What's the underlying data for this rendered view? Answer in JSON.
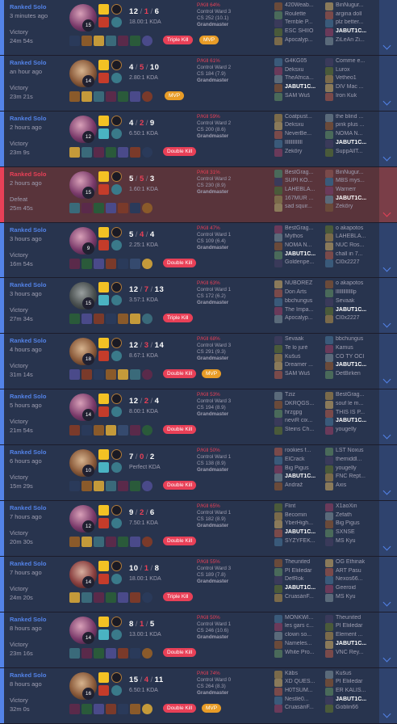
{
  "colors": {
    "win": "#28344e",
    "loss": "#59343b",
    "accent_win": "#5383e8",
    "accent_loss": "#e84057",
    "mvp": "#e89c27"
  },
  "matches": [
    {
      "queue": "Ranked Solo",
      "ago": "3 minutes ago",
      "result": "Victory",
      "duration": "24m 54s",
      "level": "15",
      "k": "12",
      "d": "1",
      "a": "6",
      "ratio": "18.00:1 KDA",
      "multikill": "Triple Kill",
      "mvp": "MVP",
      "pkill": "P/Kill 64%",
      "wards": "Control Ward 3",
      "cs": "CS 252 (10.1)",
      "rank": "Grandmaster",
      "team1": [
        "420Weab...",
        "Roulette",
        "Terrible P...",
        "ESC SHIIO",
        "Apocalyp..."
      ],
      "team2": [
        "BinNugur...",
        "argina doll",
        "plz better...",
        "JABUT1C...",
        "ZiLeAn Zi..."
      ],
      "me_team": 2,
      "me_index": 3,
      "champ": "c1",
      "spell2": "red"
    },
    {
      "queue": "Ranked Solo",
      "ago": "an hour ago",
      "result": "Victory",
      "duration": "23m 21s",
      "level": "14",
      "k": "4",
      "d": "5",
      "a": "10",
      "ratio": "2.80:1 KDA",
      "multikill": "",
      "mvp": "MVP",
      "pkill": "P/Kill 61%",
      "wards": "Control Ward 2",
      "cs": "CS 184 (7.9)",
      "rank": "Grandmaster",
      "team1": [
        "G4KG05",
        "Deksxu",
        "TheAfrica...",
        "JABUT1C...",
        "SAM Wuš"
      ],
      "team2": [
        "Comme e...",
        "Lurox",
        "Vetheo1",
        "DIV Mac ...",
        "Iron Kuk"
      ],
      "me_team": 1,
      "me_index": 3,
      "champ": "c2",
      "spell2": "red"
    },
    {
      "queue": "Ranked Solo",
      "ago": "2 hours ago",
      "result": "Victory",
      "duration": "23m 9s",
      "level": "12",
      "k": "4",
      "d": "2",
      "a": "9",
      "ratio": "6.50:1 KDA",
      "multikill": "Double Kill",
      "mvp": "",
      "pkill": "P/Kill 59%",
      "wards": "Control Ward 2",
      "cs": "CS 200 (8.6)",
      "rank": "Grandmaster",
      "team1": [
        "Coatpust...",
        "Deksxu",
        "NeverBe...",
        "llllllllllllll",
        "Zekõry"
      ],
      "team2": [
        "the blind ...",
        "pink plus ...",
        "NOMA N...",
        "JABUT1C...",
        "SuppAllT..."
      ],
      "me_team": 2,
      "me_index": 3,
      "champ": "c1",
      "spell2": "red"
    },
    {
      "queue": "Ranked Solo",
      "ago": "2 hours ago",
      "result": "Defeat",
      "duration": "25m 45s",
      "level": "15",
      "k": "5",
      "d": "5",
      "a": "3",
      "ratio": "1.60:1 KDA",
      "multikill": "",
      "mvp": "",
      "pkill": "P/Kill 31%",
      "wards": "Control Ward 2",
      "cs": "CS 230 (8.9)",
      "rank": "Grandmaster",
      "team1": [
        "BestGrag...",
        "SUPI KO...",
        "LÄHEBLÄ...",
        "167MUR ...",
        "sad squir..."
      ],
      "team2": [
        "BinNugur...",
        "MBS mys...",
        "Warnerr",
        "JABUT1C...",
        "Zekõry"
      ],
      "me_team": 2,
      "me_index": 3,
      "champ": "c1",
      "spell2": "red"
    },
    {
      "queue": "Ranked Solo",
      "ago": "3 hours ago",
      "result": "Victory",
      "duration": "16m 54s",
      "level": "9",
      "k": "5",
      "d": "4",
      "a": "4",
      "ratio": "2.25:1 KDA",
      "multikill": "Double Kill",
      "mvp": "",
      "pkill": "P/Kill 47%",
      "wards": "Control Ward 1",
      "cs": "CS 109 (6.4)",
      "rank": "Grandmaster",
      "team1": [
        "BestGrag...",
        "Mythos",
        "NOMA N...",
        "JABUT1C...",
        "Goldenpe..."
      ],
      "team2": [
        "o akapotos",
        "LÄHEBLÄ...",
        "NUC Ros...",
        "chall in 7...",
        "Cl0x2227"
      ],
      "me_team": 1,
      "me_index": 3,
      "champ": "c1",
      "spell2": "red"
    },
    {
      "queue": "Ranked Solo",
      "ago": "3 hours ago",
      "result": "Victory",
      "duration": "27m 34s",
      "level": "15",
      "k": "12",
      "d": "7",
      "a": "13",
      "ratio": "3.57:1 KDA",
      "multikill": "Triple Kill",
      "mvp": "",
      "pkill": "P/Kill 63%",
      "wards": "Control Ward 1",
      "cs": "CS 172 (6.2)",
      "rank": "Grandmaster",
      "team1": [
        "NUBÖREZ",
        "Don Arts",
        "bbchungus",
        "The Impa...",
        "Apocalyp..."
      ],
      "team2": [
        "o akapotos",
        "llllllllllllllp",
        "Sevaak",
        "JABUT1C...",
        "Cl0x2227"
      ],
      "me_team": 2,
      "me_index": 3,
      "champ": "c3",
      "spell2": "red"
    },
    {
      "queue": "Ranked Solo",
      "ago": "4 hours ago",
      "result": "Victory",
      "duration": "31m 14s",
      "level": "18",
      "k": "12",
      "d": "3",
      "a": "14",
      "ratio": "8.67:1 KDA",
      "multikill": "Double Kill",
      "mvp": "MVP",
      "pkill": "P/Kill 68%",
      "wards": "Control Ward 3",
      "cs": "CS 291 (9.3)",
      "rank": "Grandmaster",
      "team1": [
        "Sevaak",
        "Te lo juré",
        "Kušuś",
        "Dreamer ...",
        "SAM Wuš"
      ],
      "team2": [
        "bbchungus",
        "Kamus",
        "CO TY OČI",
        "JABUT1C...",
        "DetBirken"
      ],
      "me_team": 2,
      "me_index": 3,
      "champ": "c2",
      "spell2": "red"
    },
    {
      "queue": "Ranked Solo",
      "ago": "5 hours ago",
      "result": "Victory",
      "duration": "21m 54s",
      "level": "14",
      "k": "12",
      "d": "2",
      "a": "4",
      "ratio": "8.00:1 KDA",
      "multikill": "Double Kill",
      "mvp": "",
      "pkill": "P/Kill 53%",
      "wards": "Control Ward 3",
      "cs": "CS 194 (8.9)",
      "rank": "Grandmaster",
      "team1": [
        "Tziz",
        "DKRQGS...",
        "hrzgpg",
        "neviR cix...",
        "Steins Ch..."
      ],
      "team2": [
        "BestGrag...",
        "souf le m...",
        "THIS IS P...",
        "JABUT1C...",
        "yougelly"
      ],
      "me_team": 2,
      "me_index": 3,
      "champ": "c1",
      "spell2": "red"
    },
    {
      "queue": "Ranked Solo",
      "ago": "6 hours ago",
      "result": "Victory",
      "duration": "15m 29s",
      "level": "10",
      "k": "7",
      "d": "0",
      "a": "2",
      "ratio": "Perfect KDA",
      "multikill": "Double Kill",
      "mvp": "",
      "pkill": "P/Kill 50%",
      "wards": "Control Ward 1",
      "cs": "CS 138 (8.9)",
      "rank": "Grandmaster",
      "team1": [
        "rookies f...",
        "ElCrack",
        "Big Pigus",
        "JABUT1C...",
        "Andraž"
      ],
      "team2": [
        "LST Noxus",
        "themiddl...",
        "yougelly",
        "FNC Rept...",
        "Axis"
      ],
      "me_team": 1,
      "me_index": 3,
      "champ": "c2",
      "spell2": "red"
    },
    {
      "queue": "Ranked Solo",
      "ago": "7 hours ago",
      "result": "Victory",
      "duration": "20m 30s",
      "level": "12",
      "k": "9",
      "d": "2",
      "a": "6",
      "ratio": "7.50:1 KDA",
      "multikill": "Double Kill",
      "mvp": "",
      "pkill": "P/Kill 65%",
      "wards": "Control Ward 1",
      "cs": "CS 182 (8.9)",
      "rank": "Grandmaster",
      "team1": [
        "Flint",
        "Becomin",
        "YberHigh...",
        "JABUT1C...",
        "SYZYFEK..."
      ],
      "team2": [
        "X1aoXin",
        "Zefath",
        "Big Pigus",
        "SXNSE",
        "MS Kyu"
      ],
      "me_team": 1,
      "me_index": 3,
      "champ": "c1",
      "spell2": "red"
    },
    {
      "queue": "Ranked Solo",
      "ago": "7 hours ago",
      "result": "Victory",
      "duration": "24m 20s",
      "level": "14",
      "k": "10",
      "d": "1",
      "a": "8",
      "ratio": "18.00:1 KDA",
      "multikill": "Triple Kill",
      "mvp": "",
      "pkill": "P/Kill 55%",
      "wards": "Control Ward 3",
      "cs": "CS 189 (7.8)",
      "rank": "Grandmaster",
      "team1": [
        "Theunited",
        "PI Eliiledar",
        "DefRok",
        "JABUT1C...",
        "CruasánF..."
      ],
      "team2": [
        "OG Ethinak",
        "ART Pasu",
        "Nexos66...",
        "Geeroid",
        "MS Kyu"
      ],
      "me_team": 1,
      "me_index": 3,
      "champ": "c4",
      "spell2": "red"
    },
    {
      "queue": "Ranked Solo",
      "ago": "8 hours ago",
      "result": "Victory",
      "duration": "23m 16s",
      "level": "14",
      "k": "8",
      "d": "1",
      "a": "5",
      "ratio": "13.00:1 KDA",
      "multikill": "Double Kill",
      "mvp": "",
      "pkill": "P/Kill 50%",
      "wards": "Control Ward 1",
      "cs": "CS 246 (10.6)",
      "rank": "Grandmaster",
      "team1": [
        "MONKWI...",
        "les gars c...",
        "clown so...",
        "Nameles...",
        "White Pro..."
      ],
      "team2": [
        "Theunited",
        "PI Eliiledar",
        "Element ...",
        "JABUT1C...",
        "VNC Rey..."
      ],
      "me_team": 2,
      "me_index": 3,
      "champ": "c1",
      "spell2": "red"
    },
    {
      "queue": "Ranked Solo",
      "ago": "8 hours ago",
      "result": "Victory",
      "duration": "32m 0s",
      "level": "16",
      "k": "15",
      "d": "4",
      "a": "11",
      "ratio": "6.50:1 KDA",
      "multikill": "Double Kill",
      "mvp": "MVP",
      "pkill": "P/Kill 74%",
      "wards": "Control Ward 0",
      "cs": "CS 264 (8.3)",
      "rank": "Grandmaster",
      "team1": [
        "Käbs",
        "XD QUES...",
        "H0TSUM...",
        "Nestlé0...",
        "CruasánF..."
      ],
      "team2": [
        "Kušuś",
        "PI Eliiledar",
        "ER KALIS...",
        "JABUT1C...",
        "Goblin66"
      ],
      "me_team": 2,
      "me_index": 3,
      "champ": "c2",
      "spell2": "red"
    }
  ]
}
